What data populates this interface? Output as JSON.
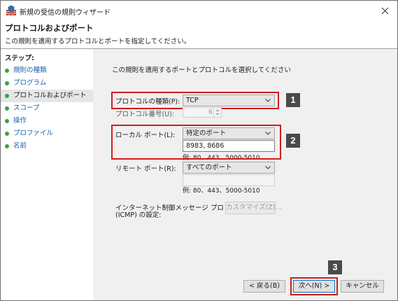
{
  "window": {
    "title": "新規の受信の規則ウィザード"
  },
  "header": {
    "title": "プロトコルおよびポート",
    "subtitle": "この規則を適用するプロトコルとポートを指定してください。"
  },
  "steps": {
    "heading": "ステップ:",
    "items": [
      {
        "label": "規則の種類"
      },
      {
        "label": "プログラム"
      },
      {
        "label": "プロトコルおよびポート"
      },
      {
        "label": "スコープ"
      },
      {
        "label": "操作"
      },
      {
        "label": "プロファイル"
      },
      {
        "label": "名前"
      }
    ],
    "current_index": 2
  },
  "main": {
    "instruction": "この規則を適用するポートとプロトコルを選択してください",
    "protocol_type": {
      "label": "プロトコルの種類(P):",
      "value": "TCP"
    },
    "protocol_number": {
      "label": "プロトコル番号(U):",
      "value": "6"
    },
    "local_port": {
      "label": "ローカル ポート(L):",
      "select_value": "特定のポート",
      "text_value": "8983, 8686",
      "example": "例: 80、443、5000-5010"
    },
    "remote_port": {
      "label": "リモート ポート(R):",
      "select_value": "すべてのポート",
      "text_value": "",
      "example": "例: 80、443、5000-5010"
    },
    "icmp": {
      "label_line1": "インターネット制御メッセージ プロトコル",
      "label_line2": "(ICMP) の設定:",
      "button": "カスタマイズ(Z)..."
    }
  },
  "footer": {
    "back": "< 戻る(B)",
    "next": "次へ(N) >",
    "cancel": "キャンセル"
  },
  "annotations": {
    "badge_1": "1",
    "badge_2": "2",
    "badge_3": "3",
    "highlight_color": "#d11c1c"
  }
}
